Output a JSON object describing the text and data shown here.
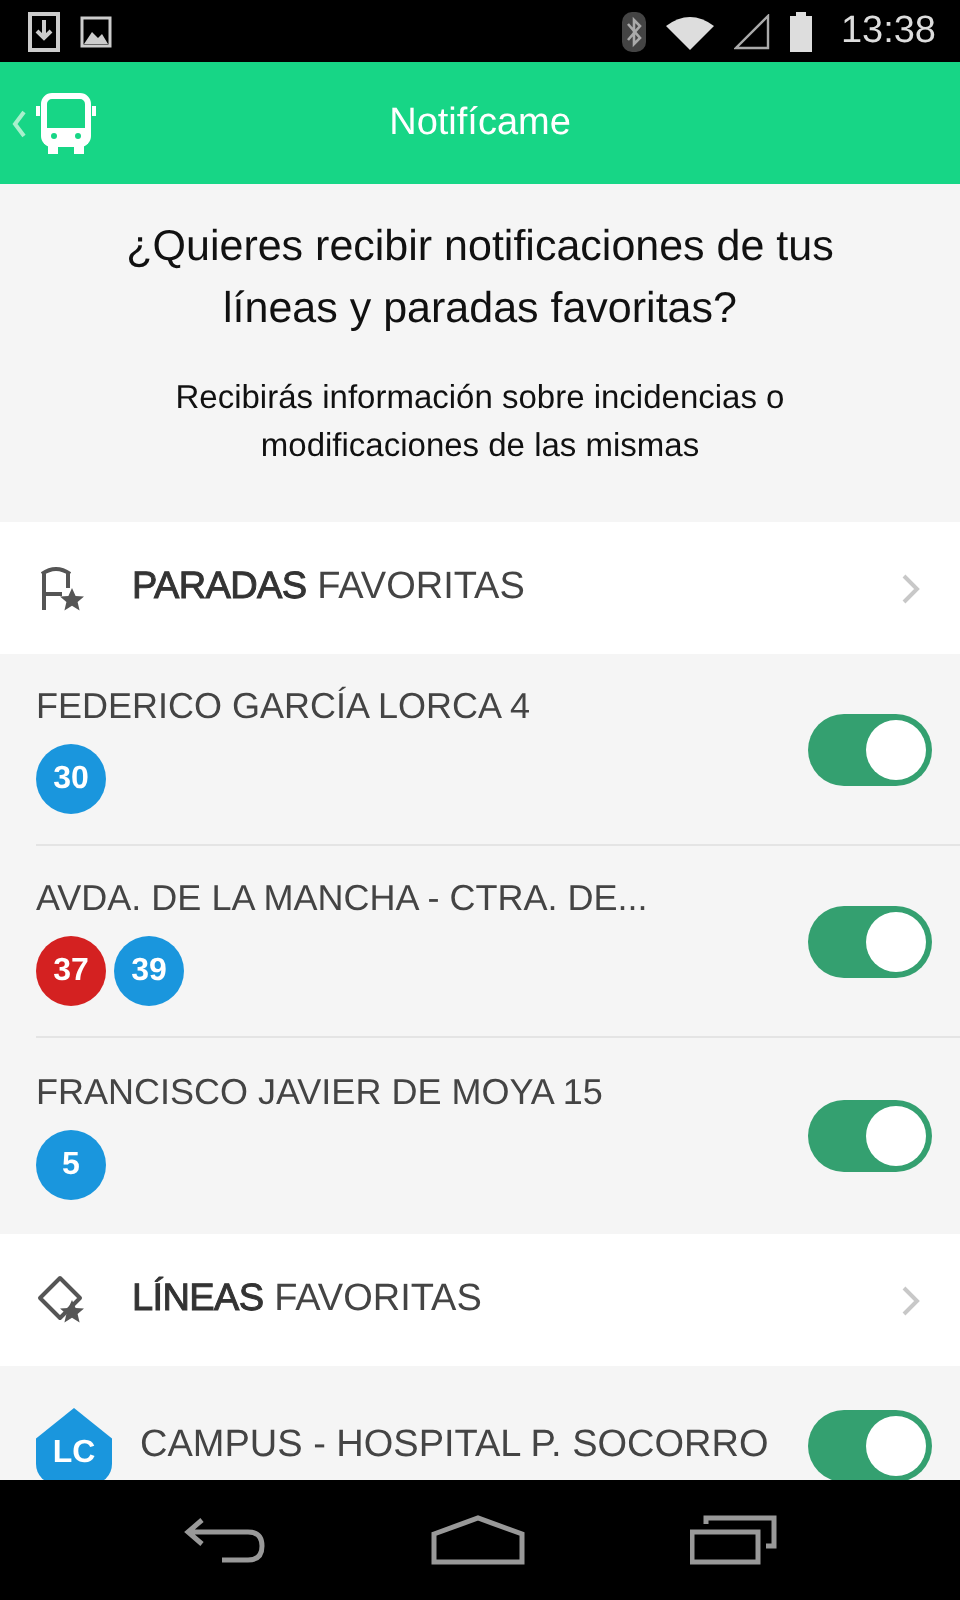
{
  "status_bar": {
    "time": "13:38"
  },
  "app_bar": {
    "title": "Notifícame"
  },
  "intro": {
    "question": "¿Quieres recibir notificaciones de tus líneas y paradas favoritas?",
    "note": "Recibirás información sobre incidencias o modificaciones de las mismas"
  },
  "sections": [
    {
      "kind": "stops",
      "title": "**PARADAS** FAVORITAS",
      "items": [
        {
          "name": "FEDERICO GARCÍA LORCA 4",
          "on": true,
          "badges": [
            {
              "label": "30",
              "color": "#1a96dd"
            }
          ]
        },
        {
          "name": "AVDA. DE LA MANCHA - CTRA. DE...",
          "on": true,
          "badges": [
            {
              "label": "37",
              "color": "#d42121"
            },
            {
              "label": "39",
              "color": "#1a96dd"
            }
          ]
        },
        {
          "name": "FRANCISCO JAVIER DE MOYA 15",
          "on": true,
          "badges": [
            {
              "label": "5",
              "color": "#1a96dd"
            }
          ]
        }
      ]
    },
    {
      "kind": "lines",
      "title": "**LÍNEAS** FAVORITAS",
      "items": [
        {
          "code": "LC",
          "color": "#1a96dd",
          "name": "CAMPUS - HOSPITAL P. SOCORRO",
          "on": true
        }
      ]
    }
  ]
}
